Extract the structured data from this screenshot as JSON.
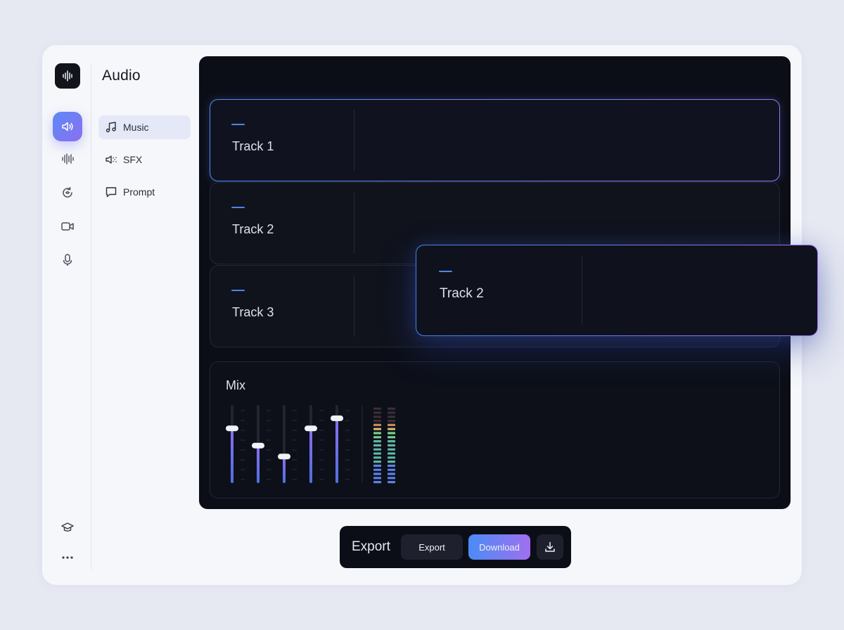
{
  "sidebar": {
    "logo": "waveform-logo",
    "items": [
      {
        "icon": "speaker-icon",
        "active": true
      },
      {
        "icon": "waveform-icon",
        "active": false
      },
      {
        "icon": "refresh-icon",
        "active": false
      },
      {
        "icon": "video-icon",
        "active": false
      },
      {
        "icon": "microphone-icon",
        "active": false
      }
    ],
    "bottom": [
      {
        "icon": "graduation-cap-icon"
      },
      {
        "icon": "more-icon"
      }
    ]
  },
  "nav": {
    "title": "Audio",
    "items": [
      {
        "label": "Music",
        "icon": "music-note-icon",
        "active": true
      },
      {
        "label": "SFX",
        "icon": "speaker-sfx-icon",
        "active": false
      },
      {
        "label": "Prompt",
        "icon": "chat-icon",
        "active": false
      }
    ]
  },
  "tracks": [
    {
      "name": "Track 1",
      "selected": true
    },
    {
      "name": "Track 2",
      "selected": false
    },
    {
      "name": "Track 3",
      "selected": false
    }
  ],
  "dragging_track": {
    "name": "Track 2"
  },
  "mix": {
    "title": "Mix",
    "fader_levels": [
      0.7,
      0.48,
      0.34,
      0.7,
      0.83
    ],
    "meter_levels": [
      0.72,
      0.76
    ]
  },
  "export_bar": {
    "label": "Export",
    "export_button": "Export",
    "download_button": "Download",
    "download_icon": "download-icon"
  },
  "colors": {
    "accent_blue": "#4a8cf4",
    "accent_purple": "#a06ff0",
    "panel": "#0c0e17"
  }
}
